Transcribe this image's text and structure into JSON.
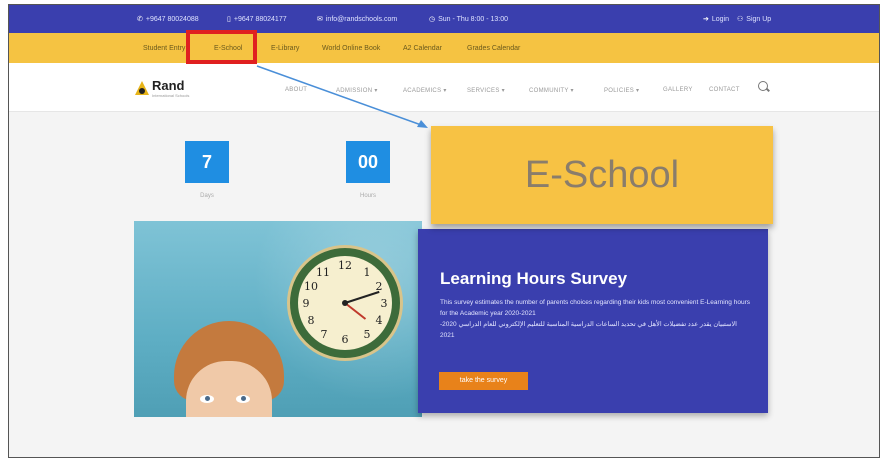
{
  "topbar": {
    "phone1": "+9647 80024088",
    "phone2": "+9647 88024177",
    "email": "info@randschools.com",
    "hours": "Sun - Thu 8:00 - 13:00",
    "login": "Login",
    "signup": "Sign Up"
  },
  "quicklinks": [
    "Student Entry",
    "E-School",
    "E-Library",
    "World Online Book",
    "A2 Calendar",
    "Grades Calendar"
  ],
  "header": {
    "logo_name": "Rand",
    "logo_tagline": "International Schools",
    "nav": [
      "ABOUT",
      "ADMISSION ▾",
      "ACADEMICS ▾",
      "SERVICES ▾",
      "COMMUNITY ▾",
      "POLICIES ▾",
      "GALLERY",
      "CONTACT"
    ]
  },
  "countdown": [
    {
      "value": "7",
      "label": "Days"
    },
    {
      "value": "00",
      "label": "Hours"
    }
  ],
  "callout": {
    "text": "E-School",
    "highlight_color": "#e02020",
    "arrow_color": "#4a8fd8"
  },
  "hero": {
    "title": "Learning Hours Survey",
    "text_en": "This survey estimates the number of parents choices regarding their kids most convenient E-Learning hours for the Academic year 2020-2021",
    "text_ar": "الاستبيان يقدر عدد تفضيلات الأهل في تحديد الساعات الدراسية المناسبة للتعليم الإلكتروني للعام الدراسي 2020-2021",
    "button": "take the survey"
  },
  "colors": {
    "topbar": "#3a3fae",
    "linkbar": "#f5c342",
    "accent_blue": "#1f8ee2",
    "button_orange": "#e8821a"
  }
}
